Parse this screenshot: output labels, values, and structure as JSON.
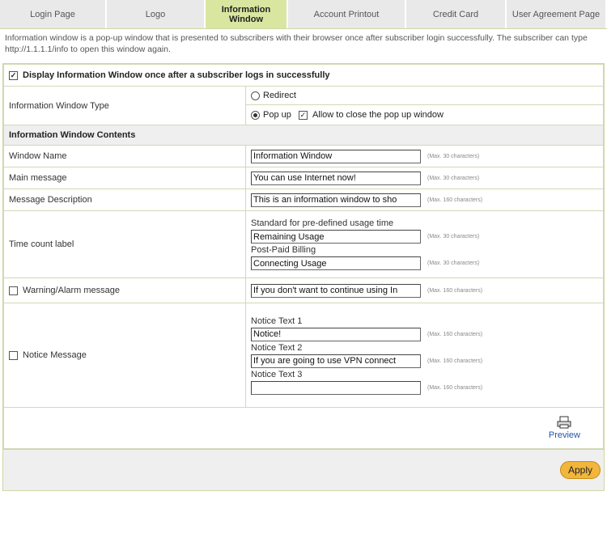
{
  "tabs": [
    {
      "label": "Login Page",
      "active": false
    },
    {
      "label": "Logo",
      "active": false
    },
    {
      "label": "Information Window",
      "active": true
    },
    {
      "label": "Account Printout",
      "active": false
    },
    {
      "label": "Credit Card",
      "active": false
    },
    {
      "label": "User Agreement Page",
      "active": false
    }
  ],
  "intro": "Information window is a pop-up window that is presented to subscribers with their browser once after subscriber login successfully. The subscriber can type http://1.1.1.1/info to open this window again.",
  "display_toggle": {
    "label": "Display Information Window once after a subscriber logs in successfully",
    "checked": true
  },
  "window_type": {
    "label": "Information Window Type",
    "redirect_label": "Redirect",
    "popup_label": "Pop up",
    "selected": "Pop up",
    "allow_close_label": "Allow to close the pop up window",
    "allow_close_checked": true
  },
  "contents_heading": "Information Window Contents",
  "fields": {
    "window_name": {
      "label": "Window Name",
      "value": "Information Window",
      "max": "(Max. 30 characters)"
    },
    "main_message": {
      "label": "Main message",
      "value": "You can use Internet now!",
      "max": "(Max. 30 characters)"
    },
    "message_description": {
      "label": "Message Description",
      "value": "This is an information window to sho",
      "max": "(Max. 160 characters)"
    }
  },
  "time_count": {
    "label": "Time count label",
    "standard_label": "Standard for pre-defined usage time",
    "standard_value": "Remaining Usage",
    "standard_max": "(Max. 30 characters)",
    "postpaid_label": "Post-Paid Billing",
    "postpaid_value": "Connecting Usage",
    "postpaid_max": "(Max. 30 characters)"
  },
  "warning": {
    "label": "Warning/Alarm message",
    "checked": false,
    "value": "If you don't want to continue using In",
    "max": "(Max. 160 characters)"
  },
  "notice": {
    "label": "Notice Message",
    "checked": false,
    "items": [
      {
        "label": "Notice Text 1",
        "value": "Notice!",
        "max": "(Max. 160 characters)"
      },
      {
        "label": "Notice Text 2",
        "value": "If you are going to use VPN connect",
        "max": "(Max. 160 characters)"
      },
      {
        "label": "Notice Text 3",
        "value": "",
        "max": "(Max. 160 characters)"
      }
    ]
  },
  "preview_label": "Preview",
  "apply_label": "Apply"
}
